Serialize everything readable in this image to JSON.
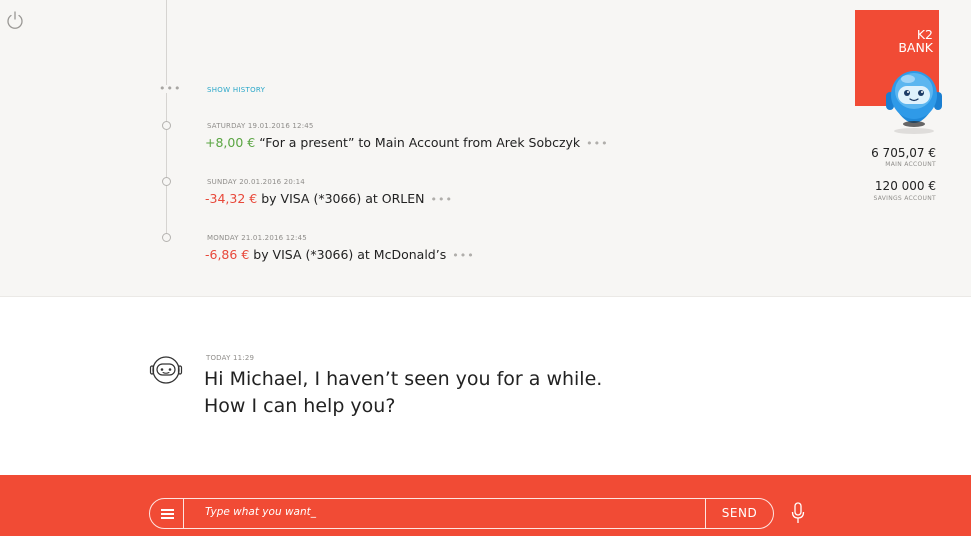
{
  "history": {
    "show_history_label": "SHOW HISTORY",
    "transactions": [
      {
        "date": "SATURDAY 19.01.2016 12:45",
        "amount": "+8,00 €",
        "amount_type": "credit",
        "description": " “For a present” to Main Account from Arek Sobczyk",
        "more": "•••"
      },
      {
        "date": "SUNDAY 20.01.2016 20:14",
        "amount": "-34,32 €",
        "amount_type": "debit",
        "description": " by VISA (*3066) at ORLEN",
        "more": "•••"
      },
      {
        "date": "MONDAY 21.01.2016 12:45",
        "amount": "-6,86 €",
        "amount_type": "debit",
        "description": " by VISA (*3066) at McDonald’s",
        "more": "•••"
      }
    ]
  },
  "brand": {
    "line1": "K2",
    "line2": "BANK"
  },
  "accounts": [
    {
      "amount": "6 705,07 €",
      "label": "MAIN ACCOUNT"
    },
    {
      "amount": "120 000 €",
      "label": "SAVINGS ACCOUNT"
    }
  ],
  "chat": {
    "timestamp": "TODAY  11:29",
    "line1": "Hi Michael, I haven’t seen you for a while.",
    "line2": "How I can help you?"
  },
  "composer": {
    "placeholder": "Type what you want_",
    "send_label": "SEND"
  },
  "colors": {
    "accent": "#f14b35",
    "credit": "#5aa542",
    "debit": "#e8483a",
    "link": "#2aa7c9",
    "panel_bg": "#f7f6f4"
  },
  "icons": [
    "power-icon",
    "menu-icon",
    "microphone-icon",
    "robot-mascot",
    "bot-avatar-icon"
  ]
}
